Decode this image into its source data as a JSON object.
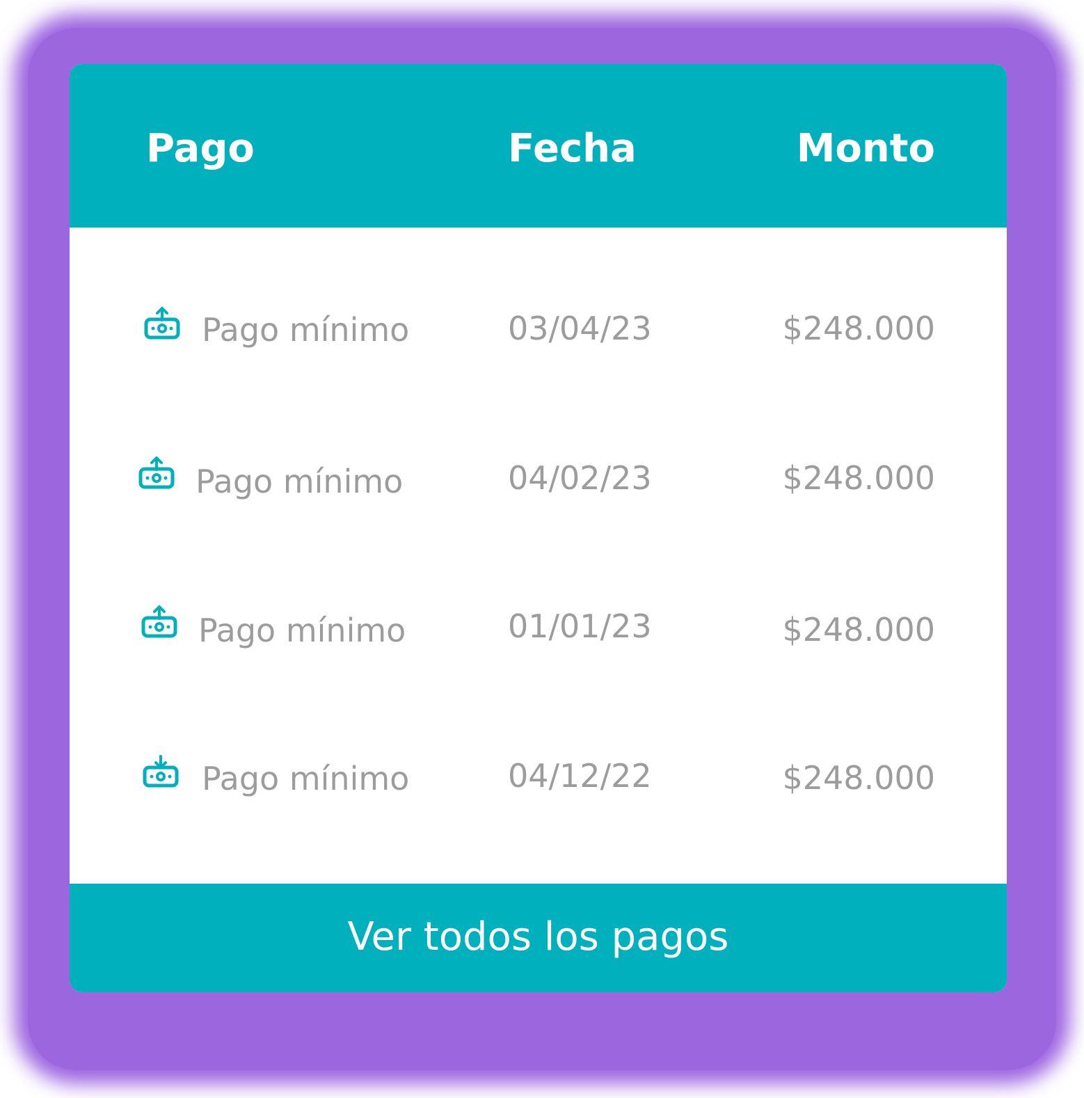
{
  "table": {
    "headers": [
      "Pago",
      "Fecha",
      "Monto"
    ],
    "rows": [
      {
        "icon": "money-upload-icon",
        "type": "Pago mínimo",
        "date": "03/04/23",
        "amount": "$248.000"
      },
      {
        "icon": "money-upload-icon",
        "type": "Pago mínimo",
        "date": "04/02/23",
        "amount": "$248.000"
      },
      {
        "icon": "money-upload-icon",
        "type": "Pago mínimo",
        "date": "01/01/23",
        "amount": "$248.000"
      },
      {
        "icon": "money-download-icon",
        "type": "Pago mínimo",
        "date": "04/12/22",
        "amount": "$248.000"
      }
    ]
  },
  "footer": {
    "button_label": "Ver todos los pagos"
  },
  "colors": {
    "accent": "#00b0bc",
    "frame": "#9c66df",
    "muted_text": "#9c9c9c"
  }
}
